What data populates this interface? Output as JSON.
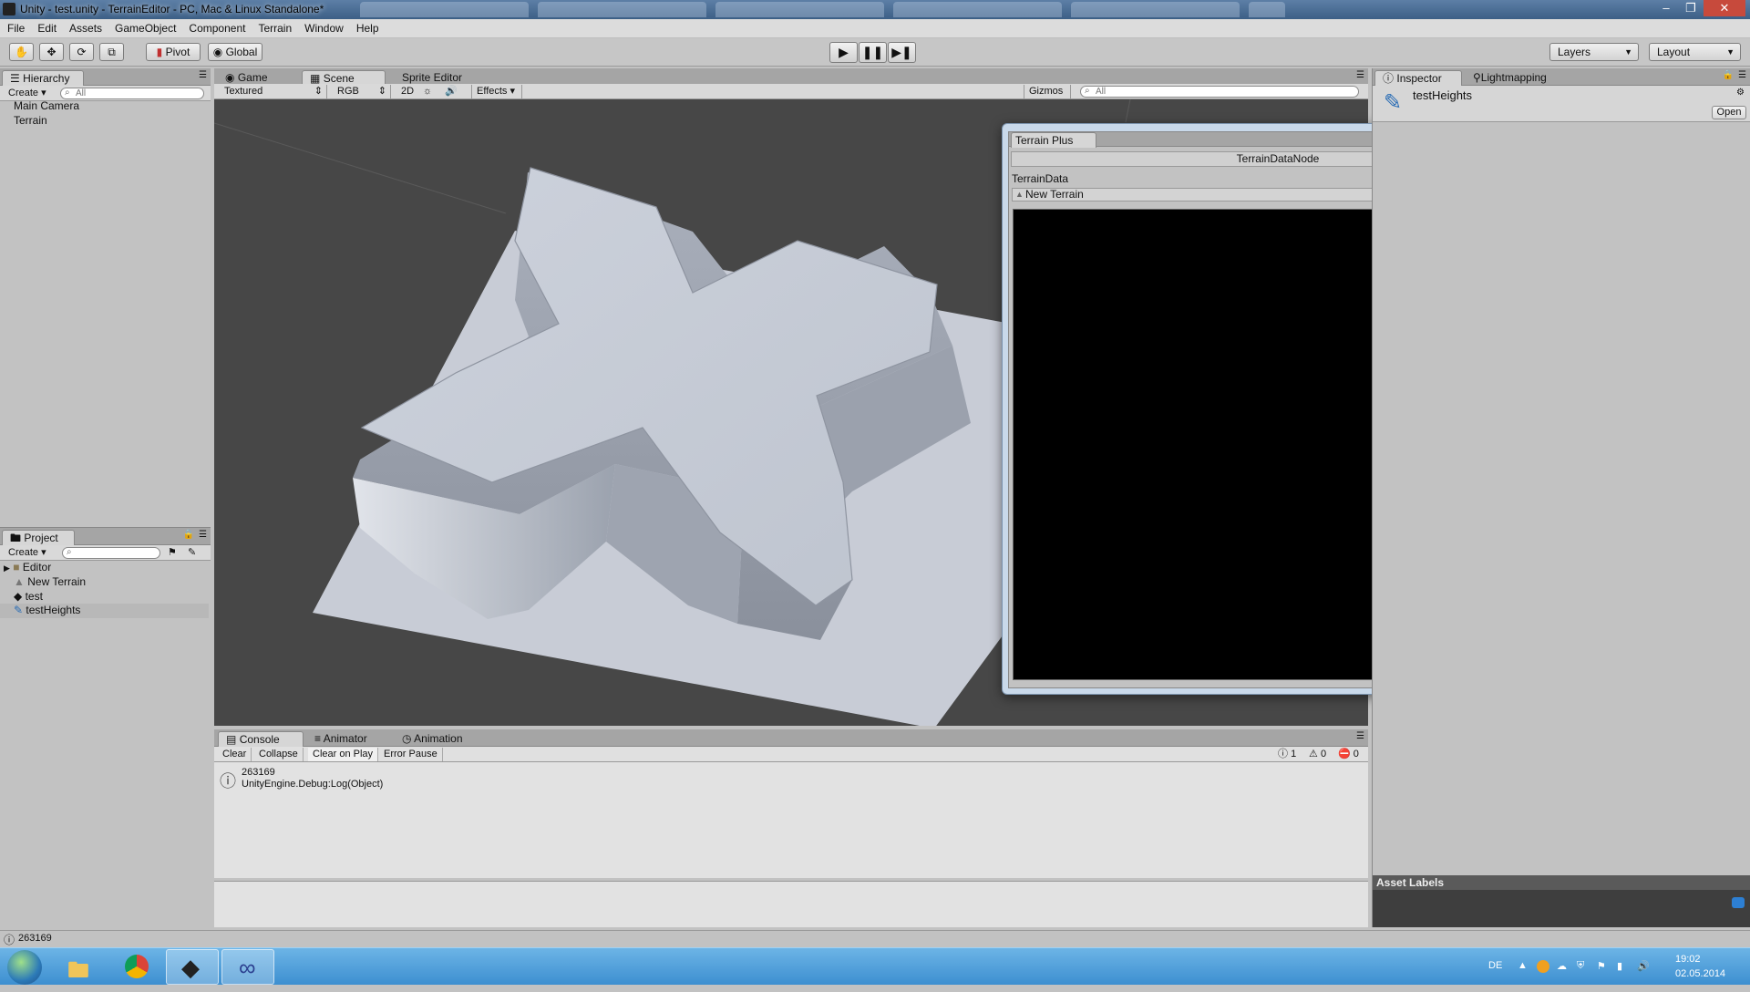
{
  "window": {
    "title": "Unity - test.unity - TerrainEditor - PC, Mac & Linux Standalone*"
  },
  "menu": [
    "File",
    "Edit",
    "Assets",
    "GameObject",
    "Component",
    "Terrain",
    "Window",
    "Help"
  ],
  "toolbar": {
    "pivot": "Pivot",
    "global": "Global",
    "layers": "Layers",
    "layout": "Layout"
  },
  "hierarchy": {
    "tab": "Hierarchy",
    "create": "Create",
    "search_placeholder": "All",
    "items": [
      "Main Camera",
      "Terrain"
    ]
  },
  "project": {
    "tab": "Project",
    "create": "Create",
    "items": [
      "Editor",
      "New Terrain",
      "test",
      "testHeights"
    ],
    "selected": "testHeights"
  },
  "scene": {
    "tabs": [
      "Game",
      "Scene",
      "Sprite Editor"
    ],
    "active_tab": "Scene",
    "shading": "Textured",
    "channel": "RGB",
    "mode2d": "2D",
    "effects": "Effects",
    "gizmos": "Gizmos",
    "search_placeholder": "All"
  },
  "terrain_plus": {
    "tab": "Terrain Plus",
    "node_title": "TerrainDataNode",
    "field_label": "TerrainData",
    "field_value": "New Terrain"
  },
  "inspector": {
    "tabs": [
      "Inspector",
      "Lightmapping"
    ],
    "asset_name": "testHeights",
    "open_button": "Open",
    "asset_labels": "Asset Labels"
  },
  "console": {
    "tabs": [
      "Console",
      "Animator",
      "Animation"
    ],
    "buttons": [
      "Clear",
      "Collapse",
      "Clear on Play",
      "Error Pause"
    ],
    "counts": {
      "info": "1",
      "warn": "0",
      "error": "0"
    },
    "entry_line1": "263169",
    "entry_line2": "UnityEngine.Debug:Log(Object)"
  },
  "status_bar": {
    "message": "263169"
  },
  "taskbar": {
    "lang": "DE",
    "time": "19:02",
    "date": "02.05.2014"
  }
}
